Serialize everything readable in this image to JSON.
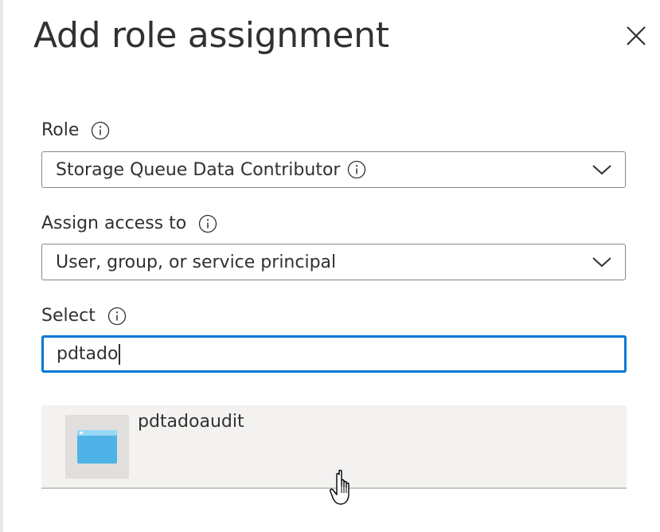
{
  "panel": {
    "title": "Add role assignment"
  },
  "role": {
    "label": "Role",
    "value": "Storage Queue Data Contributor"
  },
  "assign_access": {
    "label": "Assign access to",
    "value": "User, group, or service principal"
  },
  "select": {
    "label": "Select",
    "value": "pdtado"
  },
  "results": [
    {
      "name": "pdtadoaudit",
      "icon": "app-window-icon"
    }
  ],
  "colors": {
    "focus_border": "#0078d4",
    "result_bg": "#f3f2f1",
    "thumb_icon": "#4fb3e8"
  }
}
